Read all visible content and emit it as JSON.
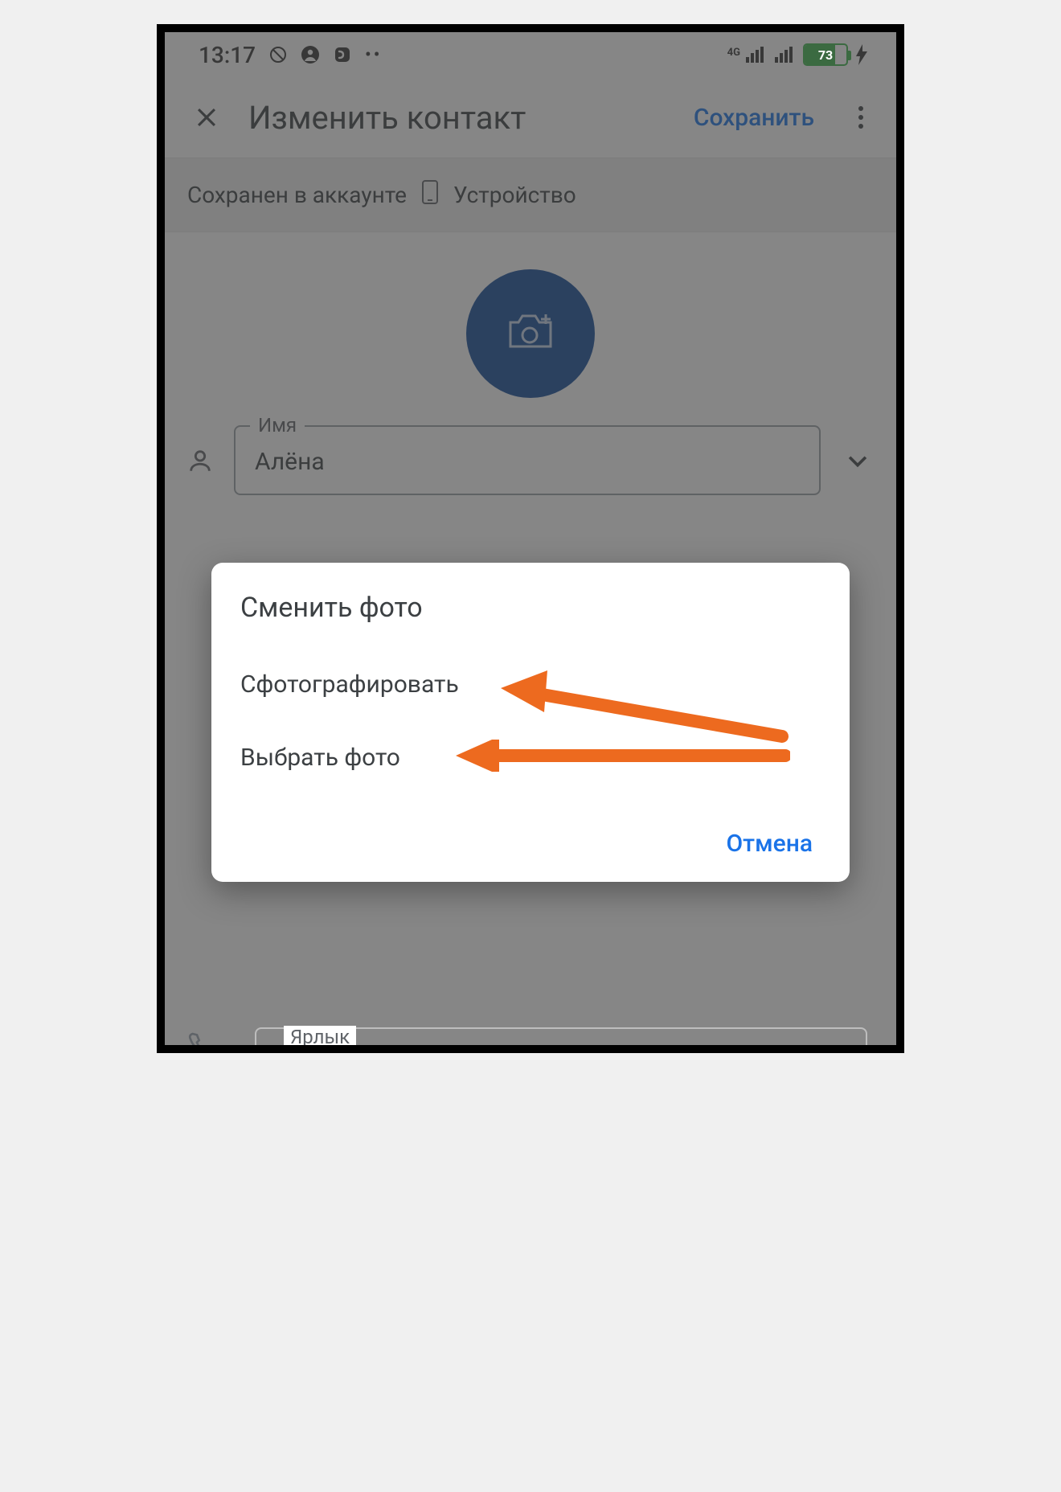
{
  "statusbar": {
    "time": "13:17",
    "network_label": "4G",
    "battery_percent": "73"
  },
  "appbar": {
    "title": "Изменить контакт",
    "save_label": "Сохранить"
  },
  "saved_strip": {
    "prefix": "Сохранен в аккаунте",
    "account": "Устройство"
  },
  "fields": {
    "name_label": "Имя",
    "name_value": "Алёна",
    "next_label": "Ярлык"
  },
  "dialog": {
    "title": "Сменить фото",
    "option_take": "Сфотографировать",
    "option_choose": "Выбрать фото",
    "cancel": "Отмена"
  }
}
